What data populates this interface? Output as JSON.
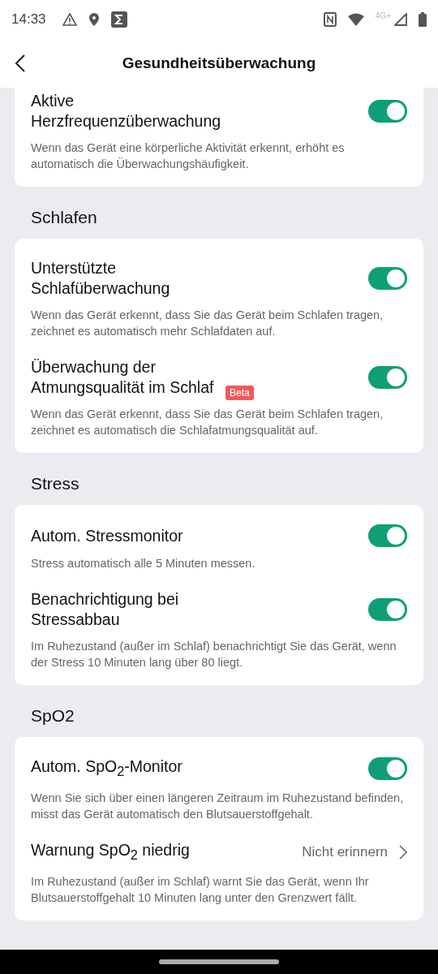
{
  "status_bar": {
    "time": "14:33",
    "network": "4G+"
  },
  "header": {
    "title": "Gesundheitsüberwachung"
  },
  "sections": [
    {
      "items": [
        {
          "kind": "toggle",
          "title": "Aktive Herzfrequenzüberwachung",
          "on": true,
          "description": "Wenn das Gerät eine körperliche Aktivität erkennt, erhöht es automatisch die Überwachungshäufigkeit."
        }
      ]
    },
    {
      "heading": "Schlafen",
      "items": [
        {
          "kind": "toggle",
          "title": "Unterstützte Schlafüberwachung",
          "on": true,
          "description": "Wenn das Gerät erkennt, dass Sie das Gerät beim Schlafen tragen, zeichnet es automatisch mehr Schlafdaten auf."
        },
        {
          "kind": "toggle",
          "title": "Überwachung der Atmungsqualität im Schlaf",
          "badge": "Beta",
          "on": true,
          "description": "Wenn das Gerät erkennt, dass Sie das Gerät beim Schlafen tragen, zeichnet es automatisch die Schlafatmungsqualität auf."
        }
      ]
    },
    {
      "heading": "Stress",
      "items": [
        {
          "kind": "toggle",
          "title": "Autom. Stressmonitor",
          "on": true,
          "description": "Stress automatisch alle 5 Minuten messen."
        },
        {
          "kind": "toggle",
          "title": "Benachrichtigung bei Stressabbau",
          "on": true,
          "description": "Im Ruhezustand (außer im Schlaf) benachrichtigt Sie das Gerät, wenn der Stress 10 Minuten lang über 80 liegt."
        }
      ]
    },
    {
      "heading": "SpO2",
      "items": [
        {
          "kind": "toggle",
          "title": "Autom. SpO$_{2}$-Monitor",
          "on": true,
          "description": "Wenn Sie sich über einen längeren Zeitraum im Ruhezustand befinden, misst das Gerät automatisch den Blutsauerstoffgehalt."
        },
        {
          "kind": "link",
          "title": "Warnung SpO$_{2}$ niedrig",
          "value": "Nicht erinnern",
          "description": "Im Ruhezustand (außer im Schlaf) warnt Sie das Gerät, wenn Ihr Blutsauerstoffgehalt 10 Minuten lang unter den Grenzwert fällt."
        }
      ]
    }
  ]
}
